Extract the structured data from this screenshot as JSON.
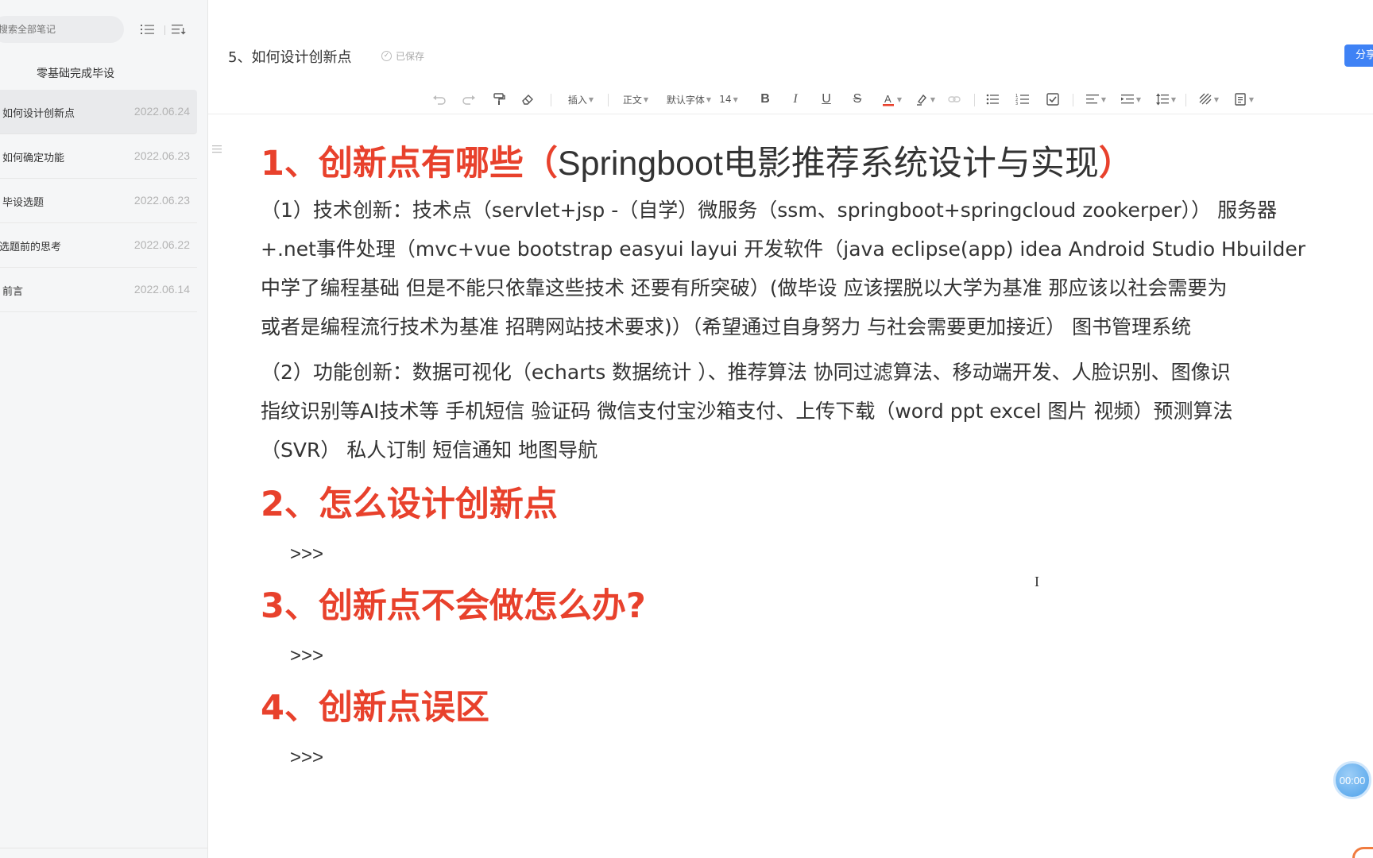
{
  "sidebar": {
    "search_placeholder": "搜索全部笔记",
    "notebook_title": "零基础完成毕设",
    "notes": [
      {
        "title": "如何设计创新点",
        "date": "2022.06.24"
      },
      {
        "title": "如何确定功能",
        "date": "2022.06.23"
      },
      {
        "title": "毕设选题",
        "date": "2022.06.23"
      },
      {
        "title": "选题前的思考",
        "date": "2022.06.22"
      },
      {
        "title": "前言",
        "date": "2022.06.14"
      }
    ]
  },
  "header": {
    "doc_title": "5、如何设计创新点",
    "saved_label": "已保存",
    "share_label": "分享"
  },
  "toolbar": {
    "insert_label": "插入",
    "paragraph_label": "正文",
    "font_label": "默认字体",
    "font_size": "14",
    "text_color": "#e8412c"
  },
  "content": {
    "h1_1_prefix": "1、创新点有哪些（",
    "h1_1_inner": "Springboot电影推荐系统设计与实现",
    "h1_1_suffix": "）",
    "p1_lines": [
      "（1）技术创新：技术点（servlet+jsp -（自学）微服务（ssm、springboot+springcloud zookerper））  服务器",
      "+.net事件处理（mvc+vue bootstrap easyui layui 开发软件（java eclipse(app) idea Android Studio Hbuilder",
      "中学了编程基础 但是不能只依靠这些技术 还要有所突破）(做毕设 应该摆脱以大学为基准 那应该以社会需要为",
      "或者是编程流行技术为基准 招聘网站技术要求)）（希望通过自身努力 与社会需要更加接近） 图书管理系统"
    ],
    "p2_lines": [
      "（2）功能创新：数据可视化（echarts 数据统计 ）、推荐算法 协同过滤算法、移动端开发、人脸识别、图像识",
      "指纹识别等AI技术等 手机短信 验证码 微信支付宝沙箱支付、上传下载（word ppt excel 图片 视频）预测算法",
      "（SVR） 私人订制 短信通知 地图导航"
    ],
    "h1_2": "2、怎么设计创新点",
    "h1_3": "3、创新点不会做怎么办?",
    "h1_4": "4、创新点误区",
    "arrow": ">>>"
  },
  "timer": "00:00",
  "colors": {
    "heading": "#e8412c",
    "accent": "#3f82f5"
  }
}
